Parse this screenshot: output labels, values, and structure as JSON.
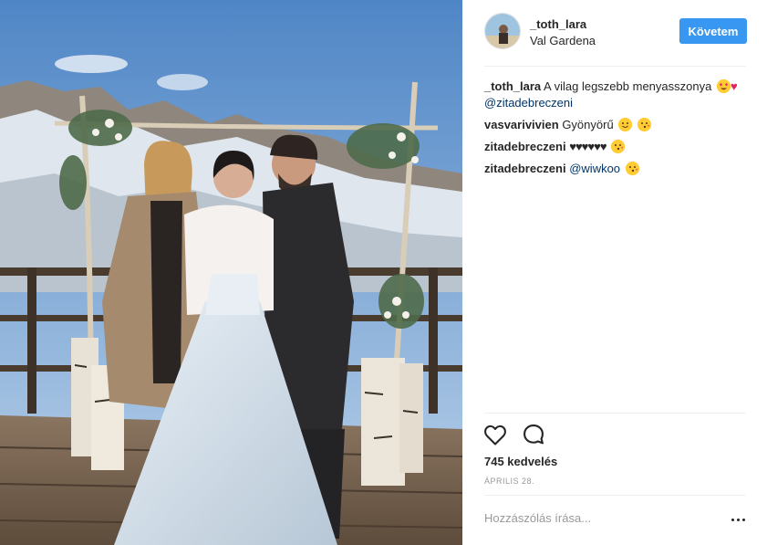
{
  "post": {
    "username": "_toth_lara",
    "location": "Val Gardena",
    "follow_label": "Követem",
    "likes": "745 kedvelés",
    "date": "ÁPRILIS 28.",
    "comment_placeholder": "Hozzászólás írása...",
    "caption": {
      "author": "_toth_lara",
      "text": "A vilag legszebb menyasszonya",
      "emoji": [
        "heart-eyes",
        "heart"
      ],
      "mention": "@zitadebreczeni"
    },
    "comments": [
      {
        "author": "vasvarivivien",
        "text": "Gyönyörű",
        "emoji": [
          "hugging-face",
          "kissing-face"
        ]
      },
      {
        "author": "zitadebreczeni",
        "hearts": "♥♥♥♥♥♥",
        "emoji": [
          "kissing-face"
        ]
      },
      {
        "author": "zitadebreczeni",
        "mention": "@wiwkoo",
        "emoji": [
          "kissing-face"
        ]
      }
    ],
    "icons": {
      "like": "heart-outline-icon",
      "comment": "speech-bubble-icon",
      "more": "more-options-icon"
    },
    "colors": {
      "accent": "#3897f0",
      "mention": "#003569",
      "muted": "#999999"
    }
  }
}
